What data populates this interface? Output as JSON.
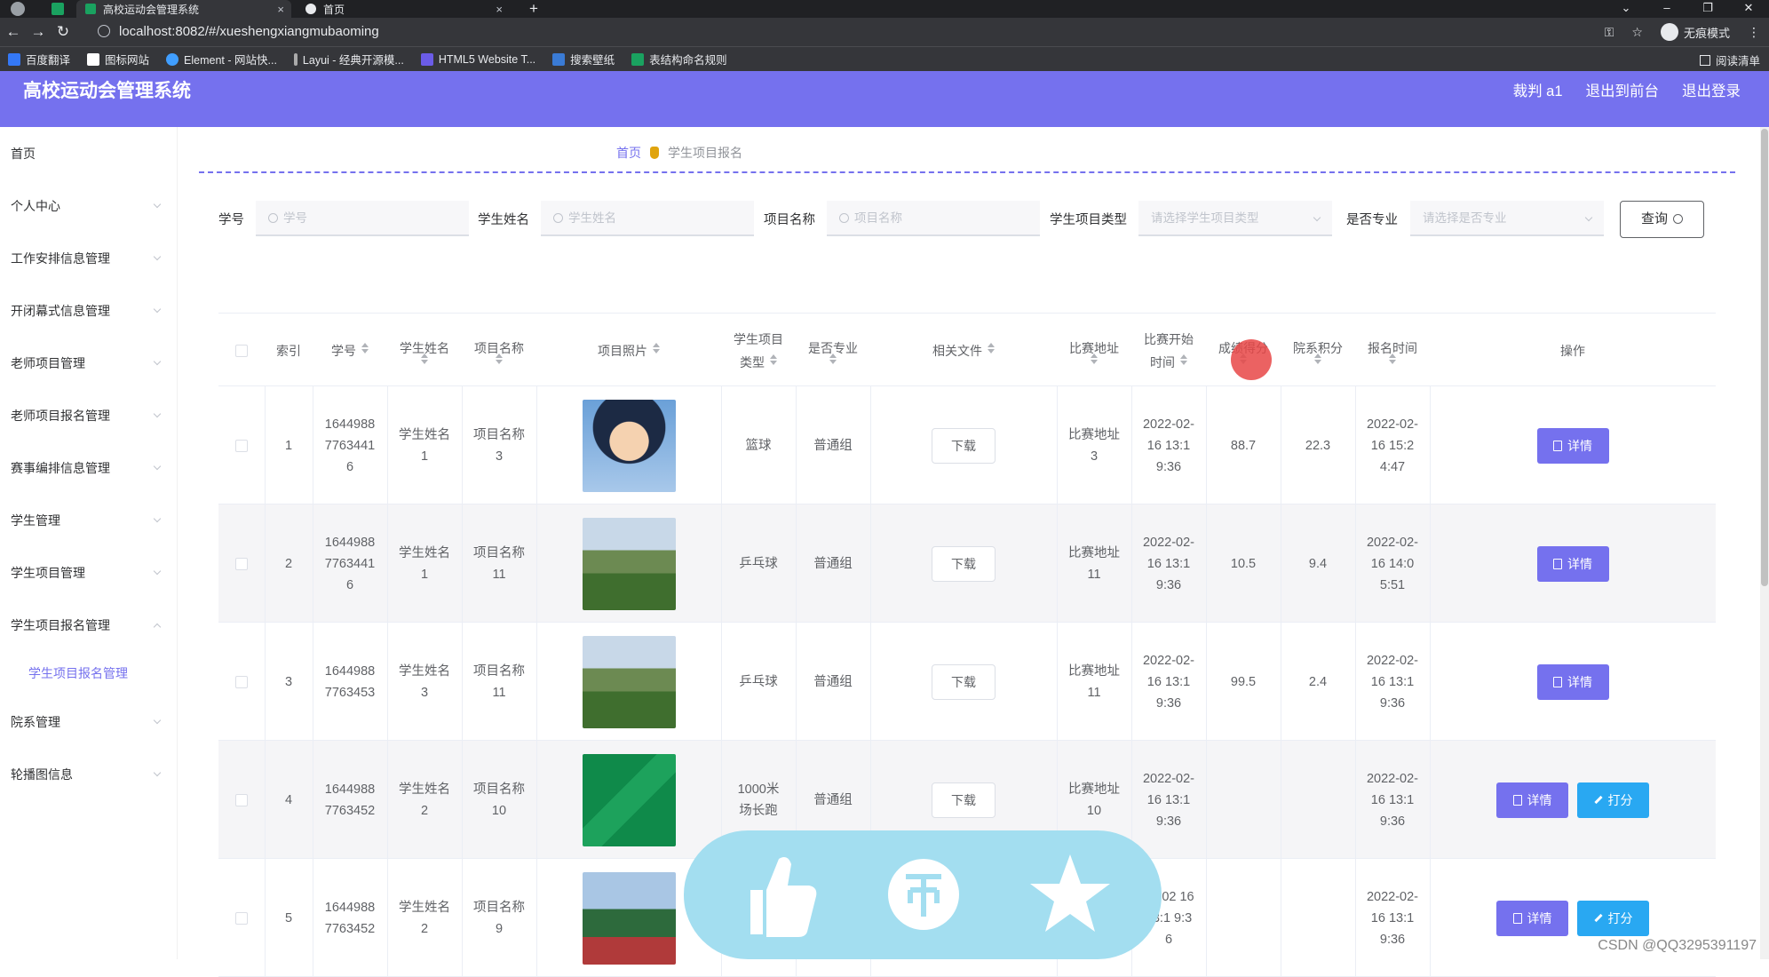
{
  "browser": {
    "tabs": [
      {
        "title": "高校运动会管理系统"
      },
      {
        "title": "首页"
      }
    ],
    "url": "localhost:8082/#/xueshengxiangmubaoming",
    "incognito_label": "无痕模式",
    "bookmarks": [
      "百度翻译",
      "图标网站",
      "Element - 网站快...",
      "Layui - 经典开源模...",
      "HTML5 Website T...",
      "搜索壁纸",
      "表结构命名规则"
    ],
    "reading_list": "阅读清单"
  },
  "app": {
    "title": "高校运动会管理系统",
    "user": "裁判 a1",
    "links": [
      "退出到前台",
      "退出登录"
    ]
  },
  "sidebar": {
    "items": [
      "首页",
      "个人中心",
      "工作安排信息管理",
      "开闭幕式信息管理",
      "老师项目管理",
      "老师项目报名管理",
      "赛事编排信息管理",
      "学生管理",
      "学生项目管理",
      "学生项目报名管理",
      "院系管理",
      "轮播图信息"
    ],
    "active_sub": "学生项目报名管理"
  },
  "breadcrumb": {
    "home": "首页",
    "current": "学生项目报名"
  },
  "filters": {
    "student_id": {
      "label": "学号",
      "placeholder": "学号"
    },
    "student_name": {
      "label": "学生姓名",
      "placeholder": "学生姓名"
    },
    "project_name": {
      "label": "项目名称",
      "placeholder": "项目名称"
    },
    "project_type": {
      "label": "学生项目类型",
      "placeholder": "请选择学生项目类型"
    },
    "is_pro": {
      "label": "是否专业",
      "placeholder": "请选择是否专业"
    },
    "query_label": "查询"
  },
  "table": {
    "headers": [
      "索引",
      "学号",
      "学生姓名",
      "项目名称",
      "项目照片",
      "学生项目类型",
      "是否专业",
      "相关文件",
      "比赛地址",
      "比赛开始时间",
      "成绩得分",
      "院系积分",
      "报名时间",
      "操作"
    ],
    "download_label": "下载",
    "detail_label": "详情",
    "score_label": "打分",
    "rows": [
      {
        "index": "1",
        "sid": "16449887763441 6",
        "sname": "学生姓名 1",
        "pname": "项目名称 3",
        "type": "篮球",
        "pro": "普通组",
        "addr": "比赛地址 3",
        "start": "2022-02-16 13:19:36",
        "score": "88.7",
        "points": "22.3",
        "reg": "2022-02-16 15:24:47",
        "can_score": false
      },
      {
        "index": "2",
        "sid": "16449887763441 6",
        "sname": "学生姓名 1",
        "pname": "项目名称 11",
        "type": "乒乓球",
        "pro": "普通组",
        "addr": "比赛地址 11",
        "start": "2022-02-16 13:19:36",
        "score": "10.5",
        "points": "9.4",
        "reg": "2022-02-16 14:05:51",
        "can_score": false
      },
      {
        "index": "3",
        "sid": "1644988 7763453",
        "sname": "学生姓名 3",
        "pname": "项目名称 11",
        "type": "乒乓球",
        "pro": "普通组",
        "addr": "比赛地址 11",
        "start": "2022-02-16 13:19:36",
        "score": "99.5",
        "points": "2.4",
        "reg": "2022-02-16 13:19:36",
        "can_score": false
      },
      {
        "index": "4",
        "sid": "1644988 7763452",
        "sname": "学生姓名 2",
        "pname": "项目名称 10",
        "type": "1000米场长跑",
        "pro": "普通组",
        "addr": "比赛地址 10",
        "start": "2022-02-16 13:19:36",
        "score": "",
        "points": "",
        "reg": "2022-02-16 13:19:36",
        "can_score": true
      },
      {
        "index": "5",
        "sid": "1644988 7763452",
        "sname": "学生姓名 2",
        "pname": "项目名称 9",
        "type": "",
        "pro": "",
        "addr": "",
        "start": "22-02 16 13:1 9:36",
        "score": "",
        "points": "",
        "reg": "2022-02-16 13:19:36",
        "can_score": true
      }
    ]
  },
  "watermark": "CSDN @QQ3295391197",
  "colors": {
    "primary": "#7571ee",
    "accent": "#29a8f2",
    "overlay": "#a3def0"
  }
}
